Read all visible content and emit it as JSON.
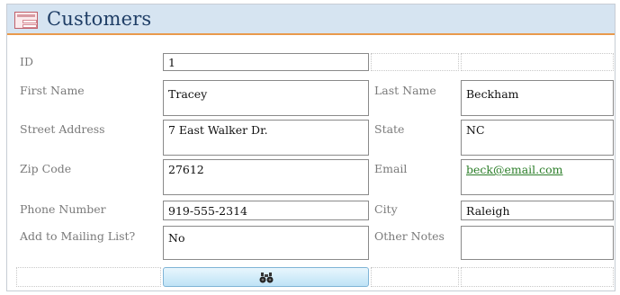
{
  "form": {
    "title": "Customers",
    "icon": "form-icon"
  },
  "fields": {
    "id": {
      "label": "ID",
      "value": "1"
    },
    "first_name": {
      "label": "First Name",
      "value": "Tracey"
    },
    "last_name": {
      "label": "Last Name",
      "value": "Beckham"
    },
    "street_address": {
      "label": "Street Address",
      "value": "7 East Walker Dr."
    },
    "state": {
      "label": "State",
      "value": "NC"
    },
    "zip_code": {
      "label": "Zip Code",
      "value": "27612"
    },
    "email": {
      "label": "Email",
      "value": "beck@email.com"
    },
    "phone_number": {
      "label": "Phone Number",
      "value": "919-555-2314"
    },
    "city": {
      "label": "City",
      "value": "Raleigh"
    },
    "mailing_list": {
      "label": "Add to Mailing List?",
      "value": "No"
    },
    "other_notes": {
      "label": "Other Notes",
      "value": ""
    }
  },
  "search_button": {
    "icon": "binoculars-icon"
  },
  "colors": {
    "header_bg": "#d6e4f1",
    "header_accent": "#e99a4c",
    "title": "#1f3e66",
    "label": "#7a7a7a",
    "link": "#2d7f2a",
    "button": "#bfe3f6"
  }
}
